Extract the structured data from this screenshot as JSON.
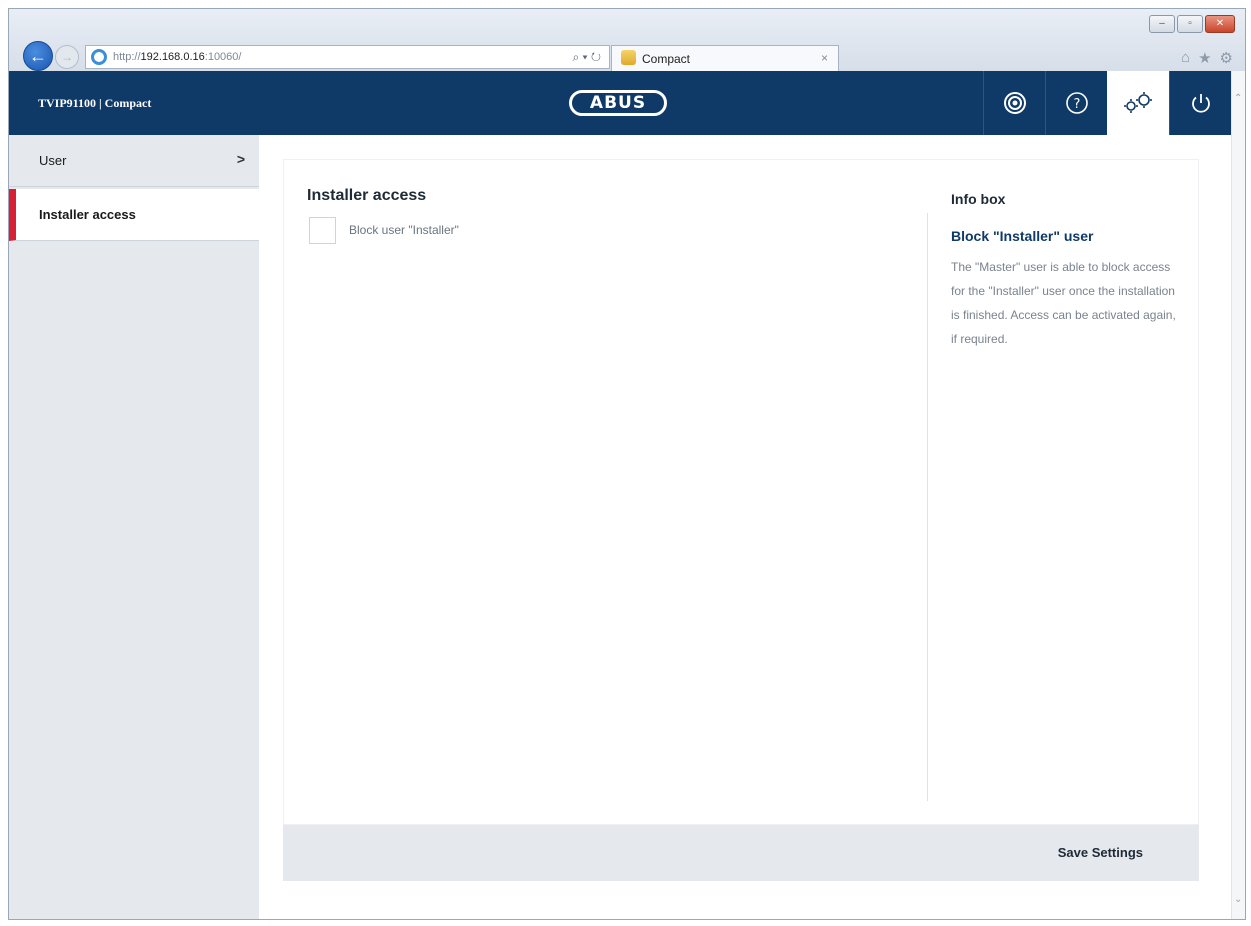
{
  "browser": {
    "url_prefix": "http://",
    "url_host": "192.168.0.16",
    "url_suffix": ":10060/",
    "search_tools": "⌕ ▾ ↻",
    "tab_title": "Compact",
    "tab_close": "×",
    "window_buttons": {
      "minimize": "–",
      "restore": "▫",
      "close": "✕"
    },
    "toolbar_icons": {
      "home": "⌂",
      "favorites": "★",
      "settings": "⚙"
    }
  },
  "header": {
    "title": "TVIP91100 | Compact",
    "logo_text": "ABUS",
    "icons": [
      "camera-icon",
      "help-icon",
      "settings-icon",
      "power-icon"
    ],
    "active_icon": "settings-icon"
  },
  "sidebar": {
    "items": [
      {
        "label": "User",
        "chevron": ">"
      },
      {
        "label": "Installer access",
        "active": true
      }
    ],
    "accent_color": "#d62035"
  },
  "main": {
    "section_title": "Installer access",
    "checkbox_label": "Block user \"Installer\"",
    "checkbox_checked": false,
    "save_label": "Save Settings"
  },
  "info_box": {
    "title": "Info box",
    "heading": "Block \"Installer\" user",
    "text": "The \"Master\" user is able to block access for the \"Installer\" user once the installation is finished. Access can be activated again, if required."
  },
  "colors": {
    "header_bg": "#0f3a68",
    "sidebar_bg": "#e5e9ee"
  }
}
